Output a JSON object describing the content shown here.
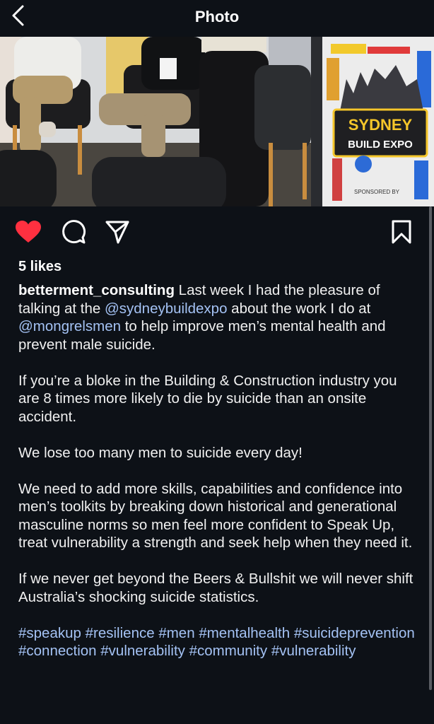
{
  "header": {
    "title": "Photo",
    "back_icon": "chevron-left-icon"
  },
  "photo": {
    "sign": {
      "line1": "SYDNEY",
      "line2": "BUILD EXPO",
      "sponsored": "SPONSORED BY"
    }
  },
  "actions": {
    "like_icon": "heart-filled-icon",
    "like_color": "#ff3040",
    "comment_icon": "comment-icon",
    "share_icon": "send-icon",
    "save_icon": "bookmark-icon"
  },
  "post": {
    "likes": "5 likes",
    "username": "betterment_consulting",
    "p1_a": " Last week I had the pleasure of talking at the ",
    "mention1": "@sydneybuildexpo",
    "p1_b": " about the work I do at ",
    "mention2": "@mongrelsmen",
    "p1_c": " to help improve men’s mental health and prevent male suicide.",
    "p2": "If you’re a bloke in the Building & Construction industry you are 8 times more likely to die by suicide than an onsite accident.",
    "p3": "We lose too many men to suicide every day!",
    "p4": "We need to add more skills, capabilities and confidence into men’s toolkits by breaking down historical and generational masculine norms so men feel more confident to Speak Up, treat vulnerability a strength and seek help when they need it.",
    "p5": "If we never get beyond the Beers & Bullshit  we will never shift Australia’s shocking suicide statistics.",
    "hashtags": [
      "#speakup",
      "#resilience",
      "#men",
      "#mentalhealth",
      "#suicideprevention",
      "#connection",
      "#vulnerability",
      "#community",
      "#vulnerability"
    ],
    "link_color": "#a4c2f4"
  }
}
